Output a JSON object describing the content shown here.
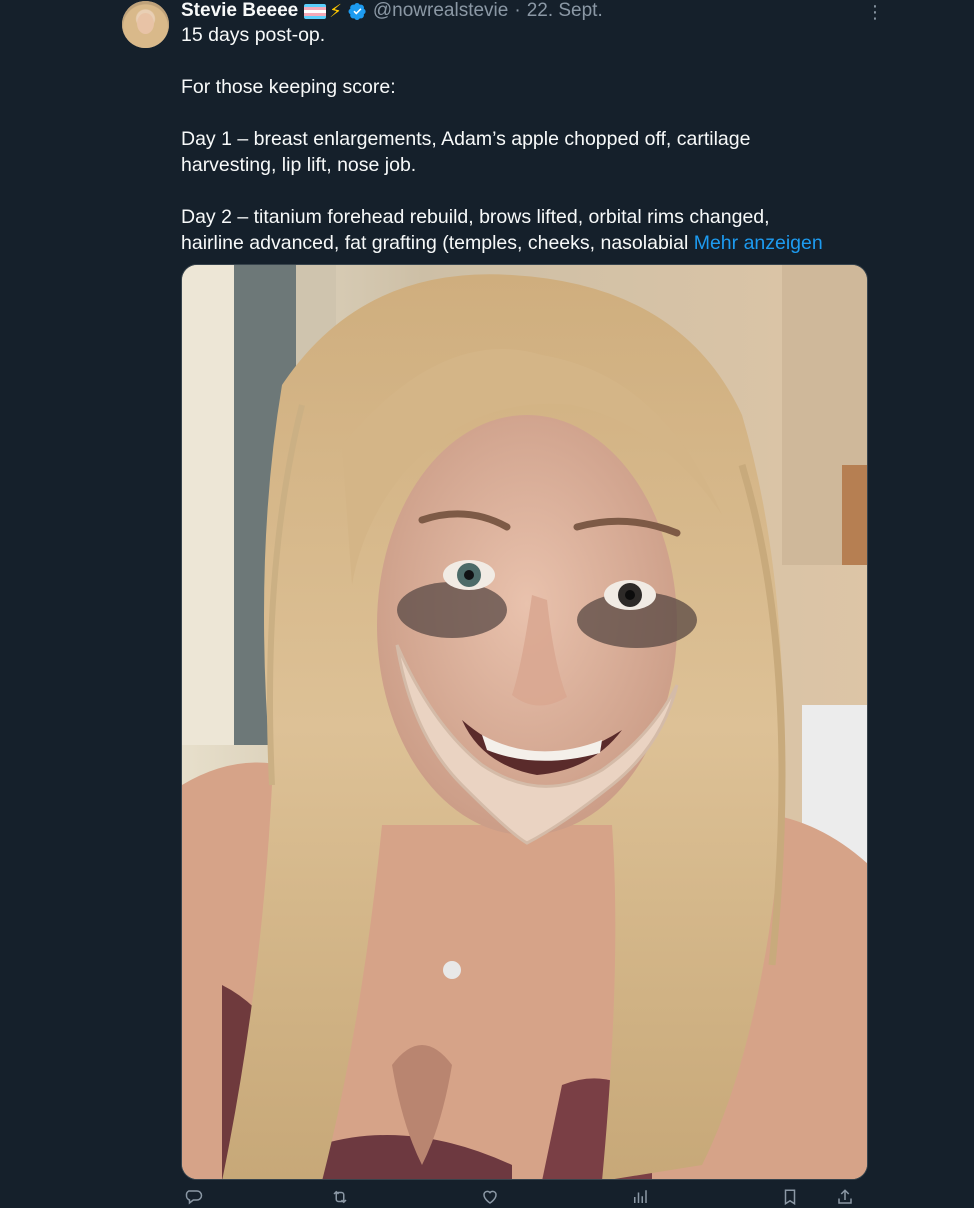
{
  "tweet": {
    "author": {
      "name": "Stevie Beeee",
      "flag_icon": "transgender-flag-emoji",
      "bolt_icon": "high-voltage-emoji",
      "bolt_glyph": "⚡",
      "verified_icon": "verified-badge-icon",
      "handle": "@nowrealstevie",
      "separator": "·",
      "date": "22. Sept."
    },
    "menu_icon": "more-options-icon",
    "menu_glyph": "⋮",
    "text": {
      "line1": "15 days post-op.",
      "line2": "For those keeping score:",
      "line3": "Day 1 – breast enlargements, Adam’s apple chopped off, cartilage",
      "line4": "harvesting, lip lift, nose job.",
      "line5": "Day 2 – titanium forehead rebuild, brows lifted, orbital rims changed,",
      "line6": "hairline advanced, fat grafting (temples, cheeks, nasolabial",
      "show_more": "Mehr anzeigen"
    },
    "media": {
      "description_icon": "photo",
      "colors": {
        "hair": "#d8b98a",
        "skin": "#e3b8a0",
        "wall": "#d9cbb4",
        "mask": "#ead3c2"
      }
    },
    "actions": [
      {
        "icon": "reply-icon"
      },
      {
        "icon": "retweet-icon"
      },
      {
        "icon": "like-icon"
      },
      {
        "icon": "views-icon"
      },
      {
        "icon": "bookmark-icon"
      },
      {
        "icon": "share-icon"
      }
    ],
    "colors": {
      "background": "#15202b",
      "text": "#f7f9f9",
      "muted": "#8b98a5",
      "link": "#1d9bf0",
      "verified": "#1d9bf0"
    }
  }
}
